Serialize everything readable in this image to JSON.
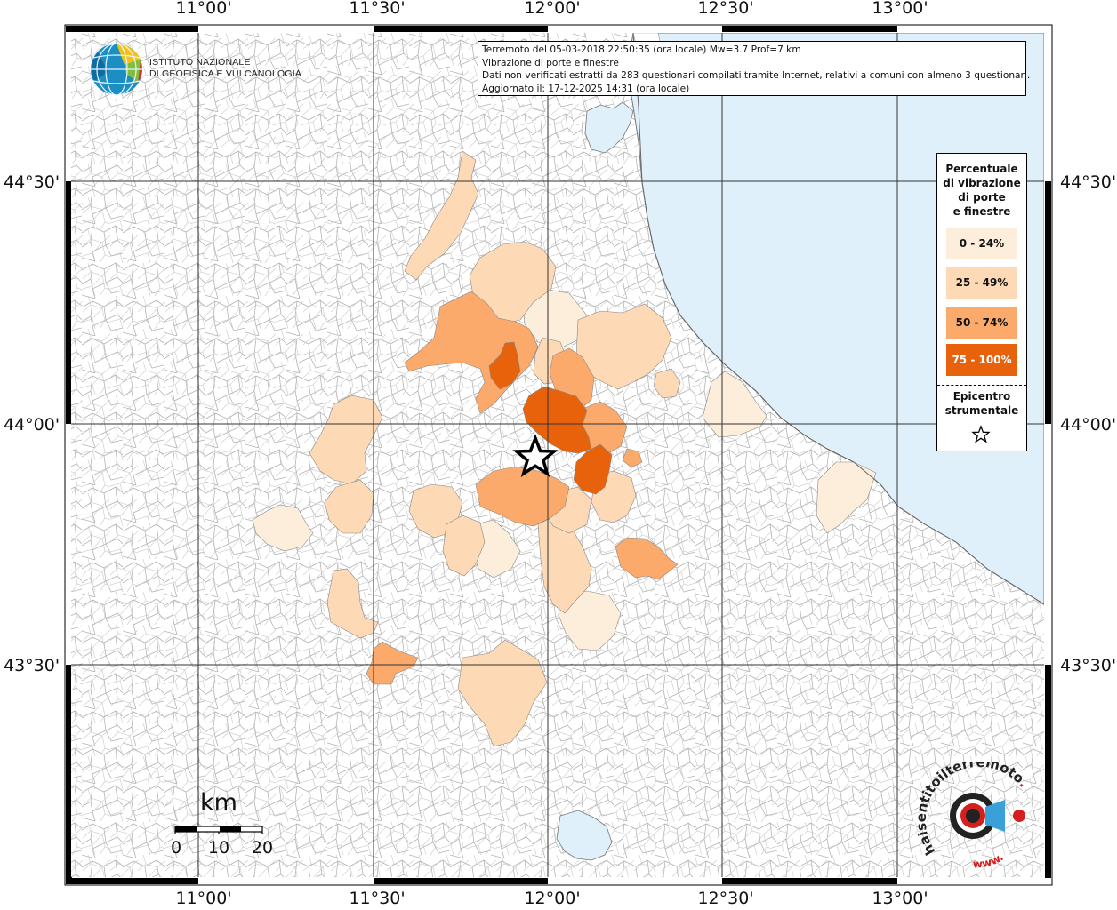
{
  "info": {
    "line1": "Terremoto del 05-03-2018 22:50:35 (ora locale) Mw=3.7 Prof=7 km",
    "line2": "Vibrazione di porte e finestre",
    "line3": "Dati non verificati estratti da 283 questionari compilati tramite Internet, relativi a comuni con almeno 3 questionari.",
    "line4": "Aggiornato il: 17-12-2025 14:31 (ora locale)"
  },
  "logo": {
    "line1": "ISTITUTO NAZIONALE",
    "line2": "DI GEOFISICA E VULCANOLOGIA"
  },
  "axes": {
    "lon_labels": [
      "11°00'",
      "11°30'",
      "12°00'",
      "12°30'",
      "13°00'"
    ],
    "lat_labels": [
      "44°30'",
      "44°00'",
      "43°30'"
    ]
  },
  "legend": {
    "title_lines": [
      "Percentuale",
      "di vibrazione",
      "di porte",
      "e finestre"
    ],
    "items": [
      {
        "label": "0 - 24%",
        "color": "#fdeedb"
      },
      {
        "label": "25 - 49%",
        "color": "#fdd9b6"
      },
      {
        "label": "50 - 74%",
        "color": "#fbaa6b"
      },
      {
        "label": "75 - 100%",
        "color": "#e8620c"
      }
    ],
    "epicenter_lines": [
      "Epicentro",
      "strumentale"
    ]
  },
  "scale": {
    "unit": "km",
    "ticks": [
      "0",
      "10",
      "20"
    ]
  },
  "brand": {
    "text1": "haisentito",
    "text2": "ilterremoto",
    "text3": ".it",
    "text4": "www."
  },
  "colors": {
    "sea": "#dff0fb",
    "border": "#aaaaaa",
    "grid": "#333333",
    "class0": "#fdeedb",
    "class1": "#fdd9b6",
    "class2": "#fbaa6b",
    "class3": "#e8620c"
  }
}
